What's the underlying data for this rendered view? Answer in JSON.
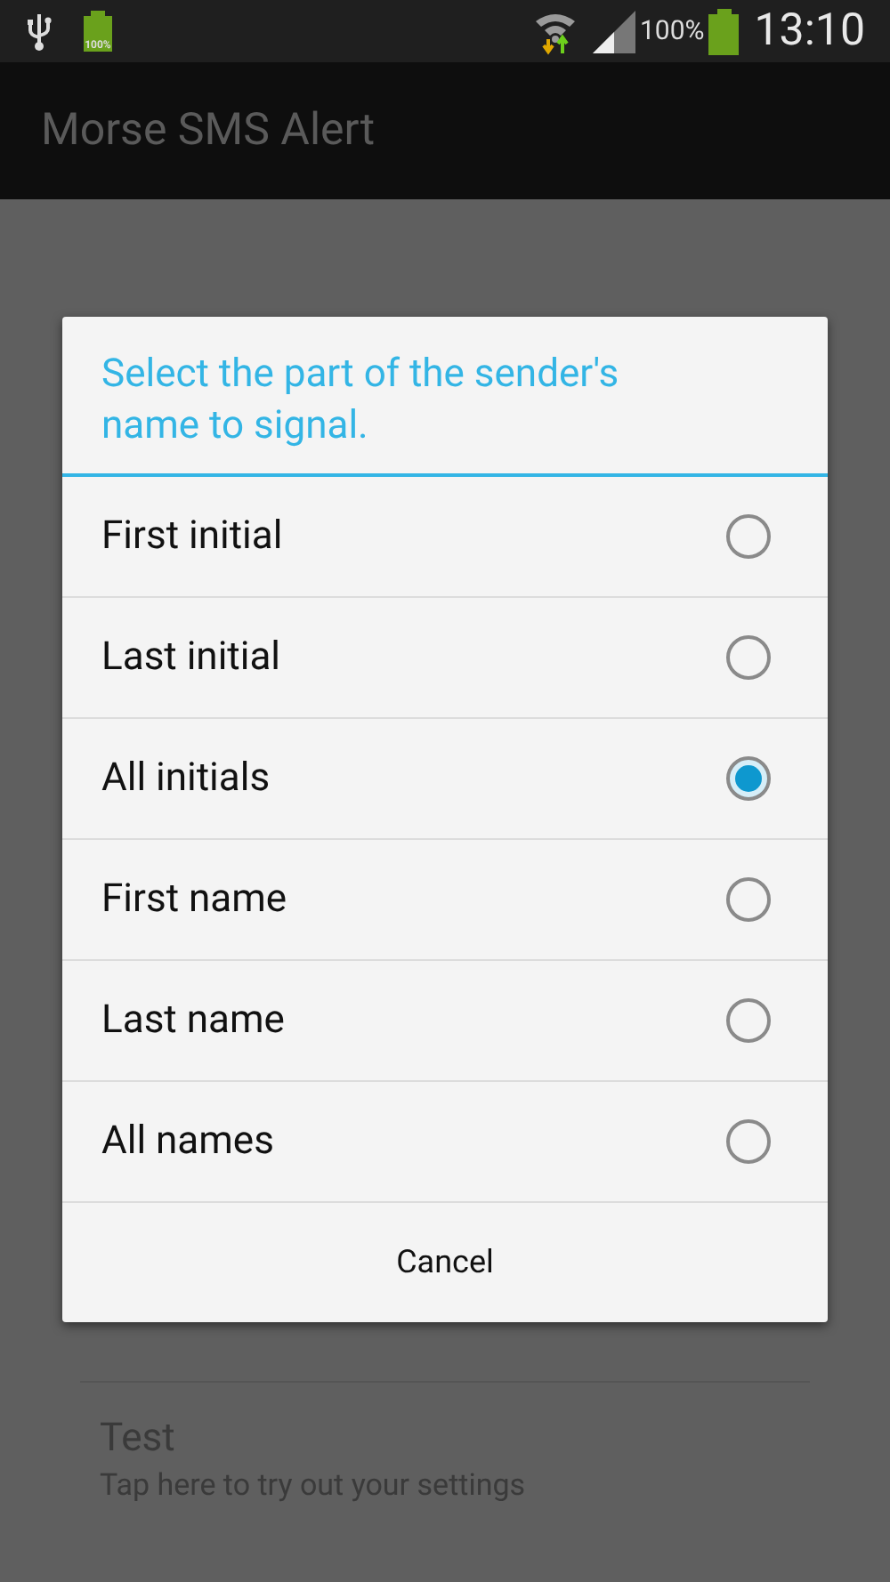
{
  "status_bar": {
    "battery_icon_label": "100%",
    "battery_percent": "100%",
    "time": "13:10"
  },
  "action_bar": {
    "title": "Morse SMS Alert"
  },
  "settings": [
    {
      "kind": "action",
      "title": "Test",
      "summary": "Tap here to try out your settings"
    }
  ],
  "dialog": {
    "title": "Select the part of the sender's name to signal.",
    "options": [
      {
        "label": "First initial",
        "selected": false
      },
      {
        "label": "Last initial",
        "selected": false
      },
      {
        "label": "All initials",
        "selected": true
      },
      {
        "label": "First name",
        "selected": false
      },
      {
        "label": "Last name",
        "selected": false
      },
      {
        "label": "All names",
        "selected": false
      }
    ],
    "cancel": "Cancel"
  }
}
